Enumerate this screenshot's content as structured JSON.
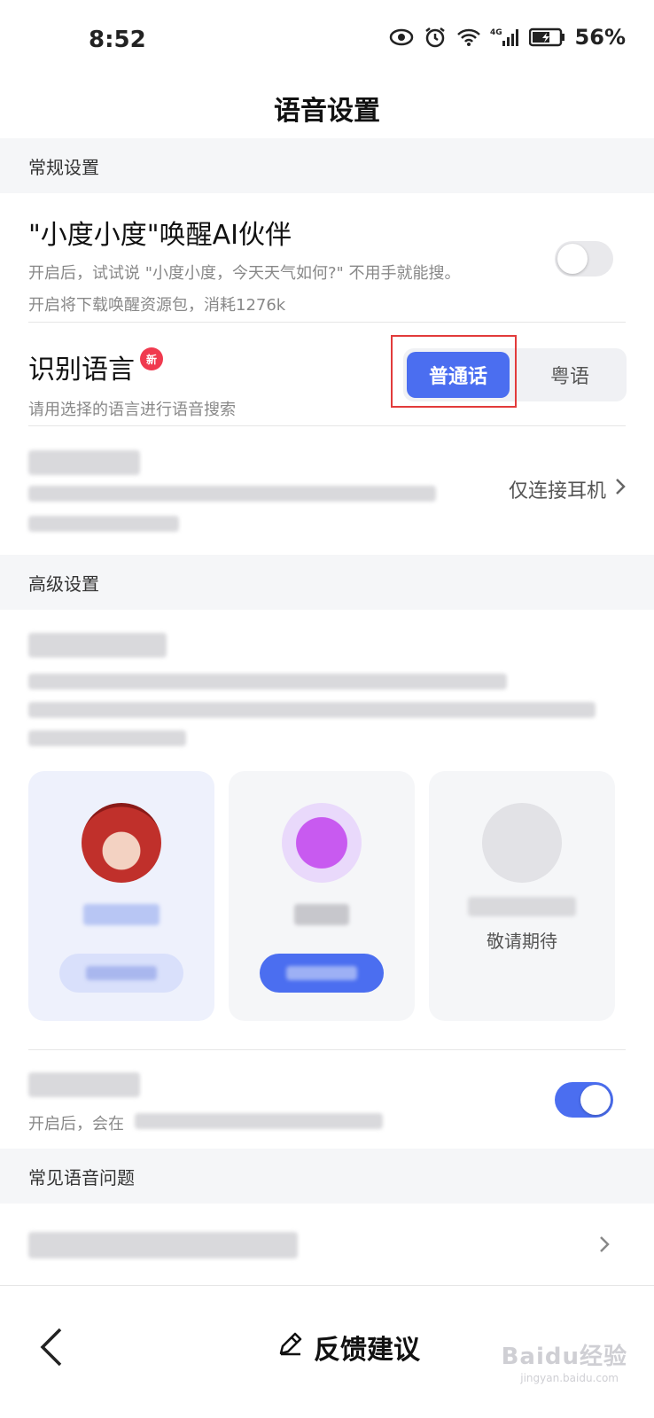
{
  "status_bar": {
    "time": "8:52",
    "battery": "56%",
    "network": "4G",
    "icons": [
      "eye-icon",
      "alarm-icon",
      "wifi-icon",
      "signal-icon",
      "battery-icon"
    ]
  },
  "header": {
    "title": "语音设置"
  },
  "sections": {
    "general": "常规设置",
    "advanced": "高级设置",
    "faq": "常见语音问题"
  },
  "wake": {
    "title": "\"小度小度\"唤醒AI伙伴",
    "desc1": "开启后，试试说 \"小度小度，今天天气如何?\" 不用手就能搜。",
    "desc2": "开启将下载唤醒资源包，消耗1276k",
    "enabled": false
  },
  "language": {
    "title": "识别语言",
    "badge": "新",
    "desc": "请用选择的语言进行语音搜索",
    "options": [
      "普通话",
      "粤语"
    ],
    "selected": "普通话"
  },
  "headset": {
    "link": "仅连接耳机"
  },
  "assistant_cards": [
    {
      "type": "anime",
      "active": true
    },
    {
      "type": "orb",
      "active": false
    },
    {
      "type": "placeholder",
      "coming": "敬请期待"
    }
  ],
  "misc_toggle": {
    "desc_prefix": "开启后，会在",
    "enabled": true
  },
  "bottom": {
    "feedback": "反馈建议",
    "watermark": "Baidu经验",
    "watermark_sub": "jingyan.baidu.com"
  },
  "colors": {
    "accent": "#4b6ef0",
    "badge": "#f03a4f",
    "highlight": "#e23b3b"
  }
}
